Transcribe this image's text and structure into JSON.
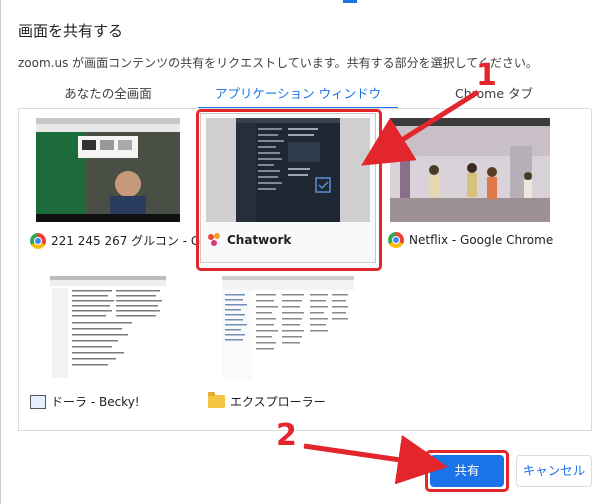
{
  "dialog": {
    "title": "画面を共有する",
    "subtitle": "zoom.us が画面コンテンツの共有をリクエストしています。共有する部分を選択してください。"
  },
  "tabs": [
    {
      "label": "あなたの全画面",
      "selected": false
    },
    {
      "label": "アプリケーション ウィンドウ",
      "selected": true
    },
    {
      "label": "Chrome タブ",
      "selected": false
    }
  ],
  "windows": [
    {
      "label": "221 245 267 グルコン - G...",
      "icon": "chrome-icon"
    },
    {
      "label": "Chatwork",
      "icon": "chatwork-icon",
      "selected": true
    },
    {
      "label": "Netflix - Google Chrome",
      "icon": "chrome-icon"
    },
    {
      "label": "ドーラ - Becky!",
      "icon": "becky-icon"
    },
    {
      "label": "エクスプローラー",
      "icon": "folder-icon"
    }
  ],
  "buttons": {
    "share": "共有",
    "cancel": "キャンセル"
  },
  "annotations": {
    "step1": "1",
    "step2": "2",
    "color": "#e3262c"
  },
  "colors": {
    "accent": "#1a73e8",
    "annotation_red": "#e3262c"
  }
}
